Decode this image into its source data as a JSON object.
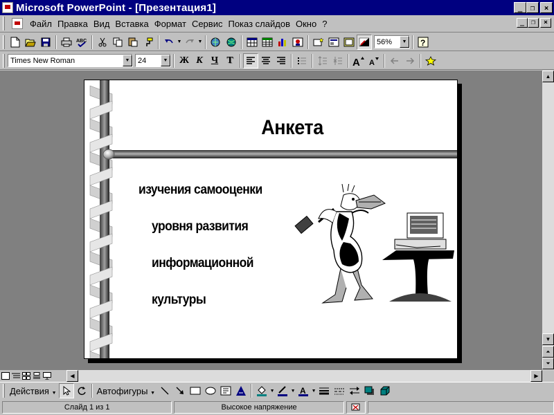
{
  "window": {
    "title": "Microsoft PowerPoint - [Презентация1]",
    "btn_min": "_",
    "btn_max": "❐",
    "btn_close": "×"
  },
  "menu": {
    "items": [
      {
        "label": "Файл"
      },
      {
        "label": "Правка"
      },
      {
        "label": "Вид"
      },
      {
        "label": "Вставка"
      },
      {
        "label": "Формат"
      },
      {
        "label": "Сервис"
      },
      {
        "label": "Показ слайдов"
      },
      {
        "label": "Окно"
      },
      {
        "label": "?"
      }
    ]
  },
  "standard_toolbar": {
    "zoom": "56%"
  },
  "format_toolbar": {
    "font_name": "Times New Roman",
    "font_size": "24",
    "bold_label": "Ж",
    "italic_label": "К",
    "underline_label": "Ч",
    "shadow_label": "Т"
  },
  "slide": {
    "title": "Анкета",
    "bullets": [
      "изучения самооценки",
      "уровня развития",
      "информационной",
      "культуры"
    ]
  },
  "drawing_toolbar": {
    "actions_label": "Действия",
    "autoshapes_label": "Автофигуры"
  },
  "status": {
    "slide_counter": "Слайд 1 из 1",
    "design_name": "Высокое напряжение"
  },
  "colors": {
    "titlebar": "#000080",
    "chrome": "#c0c0c0",
    "workspace": "#808080"
  }
}
